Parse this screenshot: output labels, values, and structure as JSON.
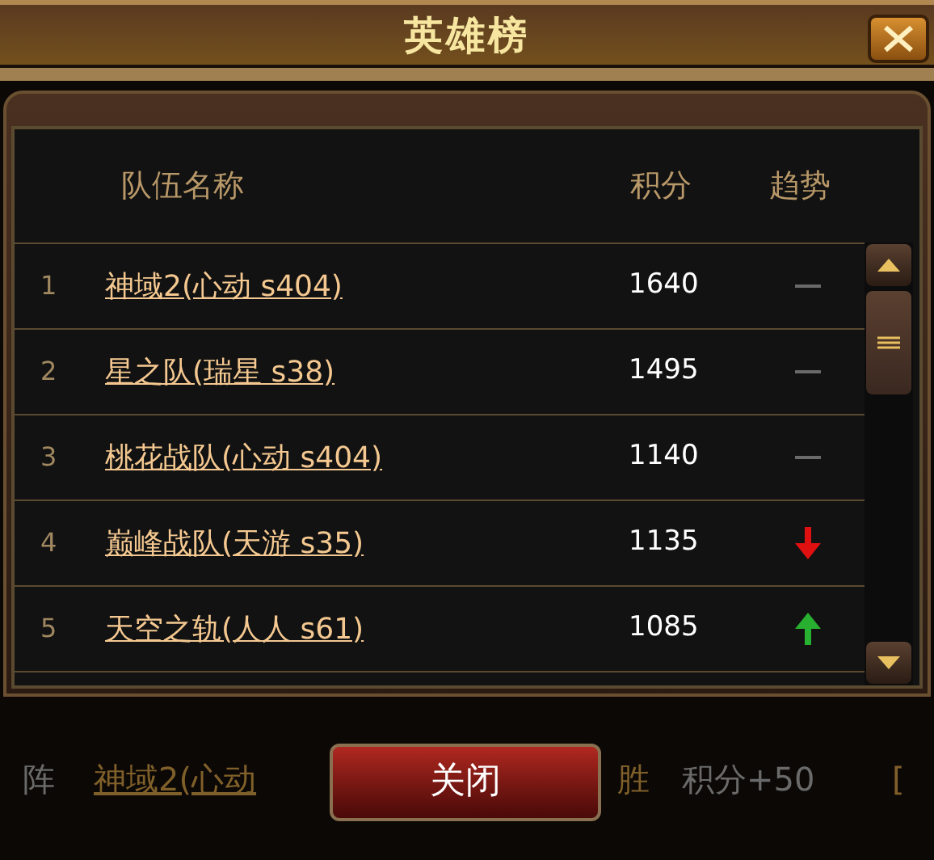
{
  "window": {
    "title": "英雄榜"
  },
  "table": {
    "columns": [
      "队伍名称",
      "积分",
      "趋势"
    ],
    "rows": [
      {
        "rank": "1",
        "name": "神域2(心动 s404)",
        "score": "1640",
        "kind": "flat"
      },
      {
        "rank": "2",
        "name": "星之队(瑞星 s38)",
        "score": "1495",
        "kind": "flat"
      },
      {
        "rank": "3",
        "name": "桃花战队(心动 s404)",
        "score": "1140",
        "kind": "flat"
      },
      {
        "rank": "4",
        "name": "巅峰战队(天游 s35)",
        "score": "1135",
        "kind": "down"
      },
      {
        "rank": "5",
        "name": "天空之轨(人人 s61)",
        "score": "1085",
        "kind": "up"
      }
    ]
  },
  "background_row": {
    "label": "阵",
    "team": "神域2(心动",
    "result": "胜",
    "points": "积分+50",
    "link": "["
  },
  "close_button": "关闭"
}
